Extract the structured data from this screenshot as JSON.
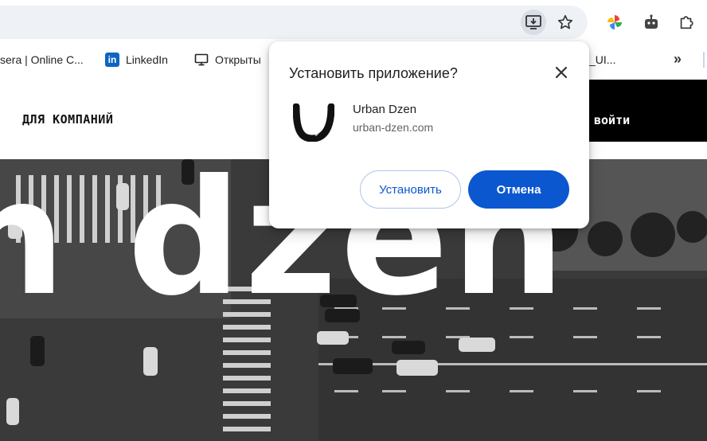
{
  "browser": {
    "icons": {
      "install": "install-app-icon",
      "bookmark": "star-icon",
      "extension1": "pinwheel-extension-icon",
      "extension2": "robot-extension-icon",
      "extensions": "puzzle-icon"
    }
  },
  "bookmarks": {
    "items": [
      {
        "label": "sera | Online C...",
        "icon": "coursera-favicon"
      },
      {
        "label": "LinkedIn",
        "icon": "linkedin-icon"
      },
      {
        "label": "Открыты",
        "icon": "monitor-icon"
      },
      {
        "label": "_UI...",
        "icon": ""
      }
    ],
    "more": "»"
  },
  "page": {
    "nav_companies": "ДЛЯ КОМПАНИЙ",
    "login": "войти",
    "hero_text": "n dzen"
  },
  "popup": {
    "title": "Установить приложение?",
    "app_name": "Urban Dzen",
    "app_url": "urban-dzen.com",
    "install_label": "Установить",
    "cancel_label": "Отмена",
    "accent_color": "#0b57d0"
  }
}
